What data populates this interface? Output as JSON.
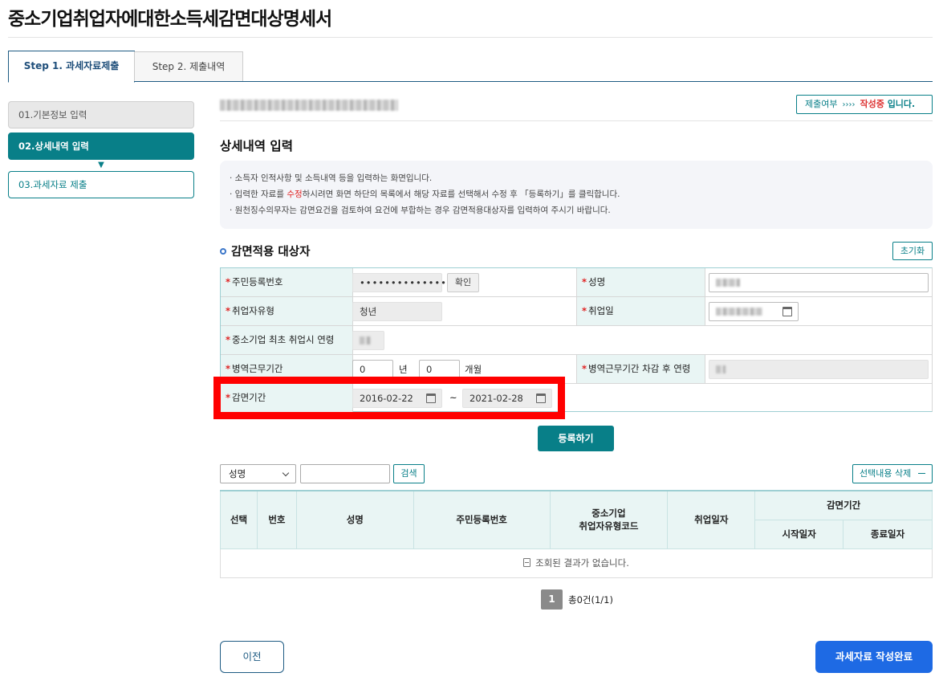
{
  "page": {
    "title": "중소기업취업자에대한소득세감면대상명세서"
  },
  "steps": [
    {
      "label": "Step 1. 과세자료제출"
    },
    {
      "label": "Step 2. 제출내역"
    }
  ],
  "sidebar": {
    "items": [
      {
        "label": "01.기본정보 입력"
      },
      {
        "label": "02.상세내역 입력"
      },
      {
        "label": "03.과세자료 제출"
      }
    ],
    "arrow": "▼"
  },
  "status": {
    "label": "제출여부",
    "arrow": "››››",
    "state": "작성중",
    "suffix": " 입니다."
  },
  "section": {
    "title": "상세내역 입력",
    "info": [
      {
        "pre": "· 소득자 인적사항 및 소득내역 등을 입력하는 화면입니다.",
        "red": "",
        "post": ""
      },
      {
        "pre": "· 입력한 자료를 ",
        "red": "수정",
        "post": "하시려면 화면 하단의 목록에서 해당 자료를 선택해서 수정 후 「등록하기」를 클릭합니다."
      },
      {
        "pre": "· 원천징수의무자는 감면요건을 검토하여 요건에 부합하는 경우 감면적용대상자를 입력하여 주시기 바랍니다.",
        "red": "",
        "post": ""
      }
    ]
  },
  "form": {
    "title": "감면적용 대상자",
    "reset_label": "초기화",
    "required_mark": "*",
    "rrn_label": "주민등록번호",
    "rrn_value": "••••••••••••••",
    "confirm_label": "확인",
    "name_label": "성명",
    "type_label": "취업자유형",
    "type_value": "청년",
    "hire_date_label": "취업일",
    "age_label": "중소기업 최초 취업시 연령",
    "military_label": "병역근무기간",
    "military_years": "0",
    "year_unit": "년",
    "military_months": "0",
    "month_unit": "개월",
    "age_after_label": "병역근무기간 차감 후 연령",
    "period_label": "감면기간",
    "period_start": "2016-02-22",
    "period_sep": "~",
    "period_end": "2021-02-28"
  },
  "register_label": "등록하기",
  "search": {
    "select_value": "성명",
    "button_label": "검색"
  },
  "delete_label": "선택내용 삭제",
  "table": {
    "headers": {
      "select": "선택",
      "no": "번호",
      "name": "성명",
      "rrn": "주민등록번호",
      "type_line1": "중소기업",
      "type_line2": "취업자유형코드",
      "hire_date": "취업일자",
      "period": "감면기간",
      "start": "시작일자",
      "end": "종료일자"
    },
    "empty_message": "조회된 결과가 없습니다."
  },
  "pager": {
    "page": "1",
    "total": "총0건(1/1)"
  },
  "footer": {
    "prev_label": "이전",
    "complete_label": "과세자료 작성완료"
  },
  "colors": {
    "teal": "#087f88",
    "navy": "#1e5b83",
    "blue": "#1e6ae4",
    "highlight": "#ff0000"
  }
}
